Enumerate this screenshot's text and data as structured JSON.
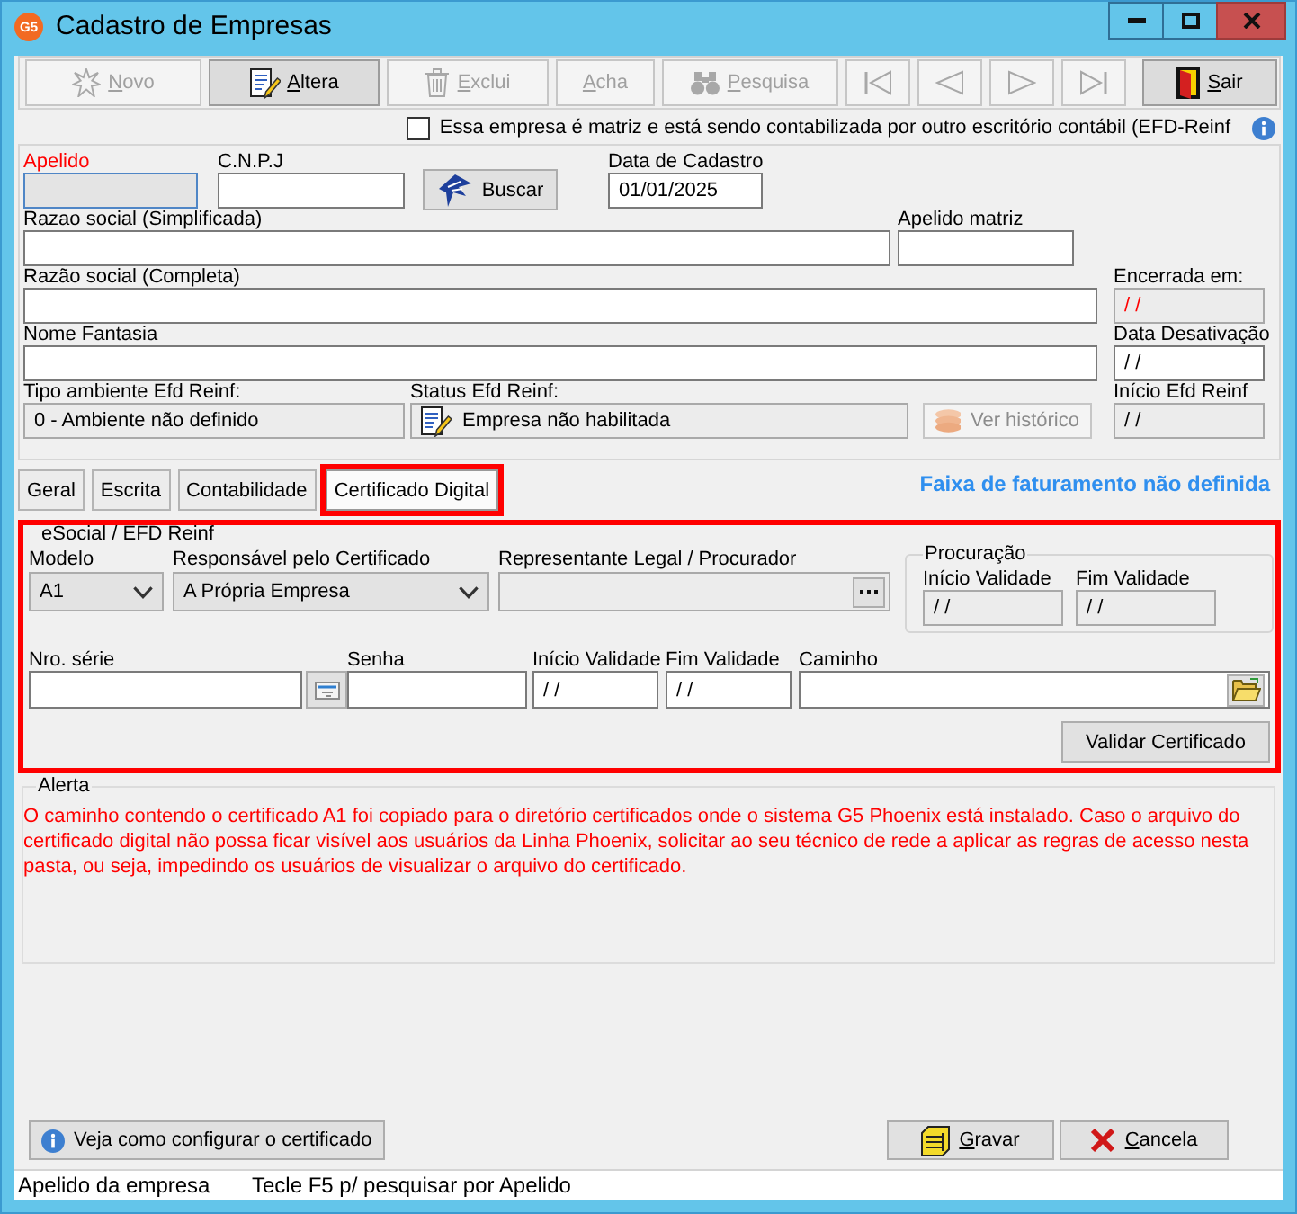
{
  "window": {
    "title": "Cadastro de Empresas",
    "logo_text": "G5"
  },
  "toolbar": [
    {
      "kind": "button",
      "label": "Novo",
      "disabled": true
    },
    {
      "kind": "button",
      "label": "Altera",
      "disabled": false
    },
    {
      "kind": "button",
      "label": "Exclui",
      "disabled": true
    },
    {
      "kind": "button",
      "label": "Acha",
      "disabled": true
    },
    {
      "kind": "button",
      "label": "Pesquisa",
      "disabled": true
    },
    {
      "kind": "first",
      "disabled": true
    },
    {
      "kind": "previous",
      "disabled": true
    },
    {
      "kind": "next",
      "disabled": true
    },
    {
      "kind": "last",
      "disabled": true
    },
    {
      "kind": "button",
      "label": "Sair",
      "disabled": false
    }
  ],
  "matriz_checkbox": {
    "label": "Essa empresa é matriz e está sendo contabilizada por outro escritório contábil (EFD-Reinf",
    "checked": false
  },
  "company": {
    "apelido": {
      "label": "Apelido",
      "required": true,
      "focused": true
    },
    "cnpj": {
      "label": "C.N.P.J"
    },
    "buscar_button": {
      "label": "Buscar"
    },
    "data_cadastro": {
      "label": "Data de Cadastro",
      "value": "01/01/2025"
    },
    "razao_simplificada": {
      "label": "Razao social (Simplificada)"
    },
    "apelido_matriz": {
      "label": "Apelido matriz"
    },
    "razao_completa": {
      "label": "Razão social (Completa)"
    },
    "encerrada_em": {
      "label": "Encerrada em:",
      "value": "/ /",
      "disabled": true,
      "warning": true
    },
    "nome_fantasia": {
      "label": "Nome Fantasia"
    },
    "data_desativacao": {
      "label": "Data Desativação",
      "value": "/ /"
    },
    "tipo_ambiente": {
      "label": "Tipo ambiente Efd Reinf:",
      "value": "0 - Ambiente não definido",
      "disabled": true
    },
    "status_efd": {
      "label": "Status Efd Reinf:",
      "value": "Empresa não habilitada",
      "disabled": true
    },
    "ver_historico_button": {
      "label": "Ver histórico",
      "disabled": true
    },
    "inicio_efd": {
      "label": "Início Efd Reinf",
      "value": "/ /",
      "disabled": true
    }
  },
  "tabs": [
    {
      "label": "Geral",
      "selected": false,
      "highlighted": false
    },
    {
      "label": "Escrita",
      "selected": false,
      "highlighted": false
    },
    {
      "label": "Contabilidade",
      "selected": false,
      "highlighted": false
    },
    {
      "label": "Certificado Digital",
      "selected": true,
      "highlighted": true
    }
  ],
  "faixa_notice": "Faixa de faturamento não definida",
  "certificado": {
    "highlighted": true,
    "group_title": "eSocial / EFD Reinf",
    "modelo": {
      "label": "Modelo",
      "value": "A1"
    },
    "responsavel": {
      "label": "Responsável pelo Certificado",
      "value": "A Própria Empresa"
    },
    "representante": {
      "label": "Representante Legal / Procurador",
      "disabled": true
    },
    "procuracao": {
      "title": "Procuração",
      "inicio": {
        "label": "Início Validade",
        "value": "/ /",
        "disabled": true
      },
      "fim": {
        "label": "Fim Validade",
        "value": "/ /",
        "disabled": true
      }
    },
    "nro_serie": {
      "label": "Nro. série"
    },
    "senha": {
      "label": "Senha"
    },
    "inicio_validade": {
      "label": "Início Validade",
      "value": "/ /"
    },
    "fim_validade": {
      "label": "Fim Validade",
      "value": "/ /"
    },
    "caminho": {
      "label": "Caminho"
    },
    "validar_button": {
      "label": "Validar Certificado"
    }
  },
  "alert": {
    "title": "Alerta",
    "message": "O caminho contendo o certificado A1 foi copiado para o diretório certificados onde o sistema G5 Phoenix está instalado. Caso o arquivo do certificado digital não possa ficar visível aos usuários da Linha Phoenix, solicitar ao seu técnico de rede a aplicar as regras de acesso nesta pasta, ou seja, impedindo os usuários de visualizar o arquivo do certificado."
  },
  "help_button": {
    "label": "Veja como configurar o certificado"
  },
  "actions": [
    {
      "label": "Gravar"
    },
    {
      "label": "Cancela"
    }
  ],
  "status_bar": [
    "Apelido da empresa",
    "Tecle F5 p/ pesquisar por Apelido"
  ]
}
